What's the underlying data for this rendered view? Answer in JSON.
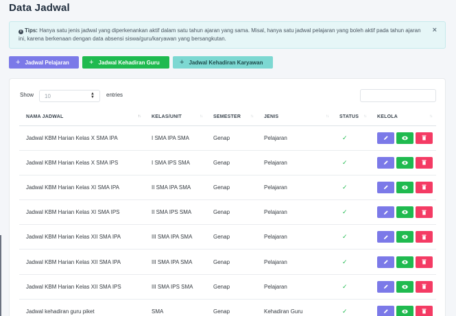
{
  "page": {
    "title": "Data Jadwal"
  },
  "alert": {
    "icon": "info-icon",
    "label": "Tips:",
    "text": " Hanya satu jenis jadwal yang diperkenankan aktif dalam satu tahun ajaran yang sama. Misal, hanya satu jadwal pelajaran yang boleh aktif pada tahun ajaran ini, karena berkenaan dengan data absensi siswa/guru/karyawan yang bersangkutan.",
    "close": "×"
  },
  "buttons": {
    "plus": "+",
    "pelajaran": "Jadwal Pelajaran",
    "guru": "Jadwal Kehadiran Guru",
    "karyawan": "Jadwal Kehadiran Karyawan"
  },
  "table_controls": {
    "show": "Show",
    "entries_value": "10",
    "entries": "entries",
    "search_value": ""
  },
  "columns": [
    "NAMA JADWAL",
    "KELAS/UNIT",
    "SEMESTER",
    "JENIS",
    "STATUS",
    "KELOLA"
  ],
  "rows": [
    {
      "nama": "Jadwal KBM Harian Kelas X SMA IPA",
      "kelas": "I SMA IPA SMA",
      "semester": "Genap",
      "jenis": "Pelajaran",
      "status": "✓"
    },
    {
      "nama": "Jadwal KBM Harian Kelas X SMA IPS",
      "kelas": "I SMA IPS SMA",
      "semester": "Genap",
      "jenis": "Pelajaran",
      "status": "✓"
    },
    {
      "nama": "Jadwal KBM Harian Kelas XI SMA IPA",
      "kelas": "II SMA IPA SMA",
      "semester": "Genap",
      "jenis": "Pelajaran",
      "status": "✓"
    },
    {
      "nama": "Jadwal KBM Harian Kelas XI SMA IPS",
      "kelas": "II SMA IPS SMA",
      "semester": "Genap",
      "jenis": "Pelajaran",
      "status": "✓"
    },
    {
      "nama": "Jadwal KBM Harian Kelas XII SMA IPA",
      "kelas": "III SMA IPA SMA",
      "semester": "Genap",
      "jenis": "Pelajaran",
      "status": "✓"
    },
    {
      "nama": "Jadwal KBM Harian Kelas XII SMA IPA",
      "kelas": "III SMA IPA SMA",
      "semester": "Genap",
      "jenis": "Pelajaran",
      "status": "✓"
    },
    {
      "nama": "Jadwal KBM Harian Kelas XII SMA IPS",
      "kelas": "III SMA IPS SMA",
      "semester": "Genap",
      "jenis": "Pelajaran",
      "status": "✓"
    },
    {
      "nama": "Jadwal kehadiran guru piket",
      "kelas": "SMA",
      "semester": "Genap",
      "jenis": "Kehadiran Guru",
      "status": "✓"
    }
  ],
  "colors": {
    "edit": "#7b79e8",
    "view": "#1fba4f",
    "delete": "#f43b64",
    "status": "#1fba4f"
  }
}
